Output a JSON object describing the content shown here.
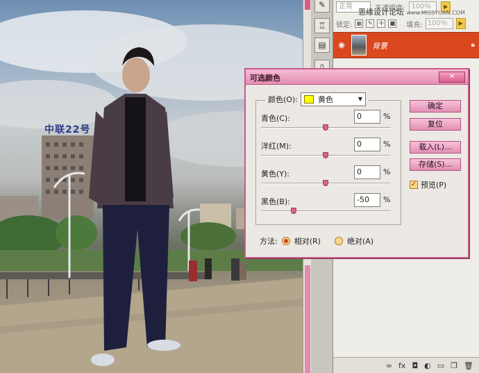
{
  "photo": {
    "building_sign": "中联22号"
  },
  "layers_panel": {
    "blend_mode": "正常",
    "opacity_label": "不透明度:",
    "opacity_value": "100%",
    "lock_label": "锁定:",
    "fill_label": "填充:",
    "fill_value": "100%",
    "watermark": "思缘设计论坛",
    "watermark_url": "www.MISSYUAN.COM",
    "layer_name": "背景"
  },
  "dialog": {
    "title": "可选颜色",
    "close_label": "✕",
    "colors_label": "颜色(O):",
    "colors_value": "黄色",
    "sliders": [
      {
        "label": "青色(C):",
        "value": "0",
        "unit": "%",
        "level": 0
      },
      {
        "label": "洋红(M):",
        "value": "0",
        "unit": "%",
        "level": 0
      },
      {
        "label": "黄色(Y):",
        "value": "0",
        "unit": "%",
        "level": 0
      },
      {
        "label": "黑色(B):",
        "value": "-50",
        "unit": "%",
        "level": -50
      }
    ],
    "method_label": "方法:",
    "method_relative": "相对(R)",
    "method_absolute": "绝对(A)",
    "method_selected": "relative",
    "buttons": {
      "ok": "确定",
      "reset": "复位",
      "load": "载入(L)...",
      "save": "存储(S)..."
    },
    "preview_label": "预览(P)",
    "preview_checked": true
  },
  "colors": {
    "accent": "#e290b4",
    "layer_selected": "#d9481f",
    "swatch_yellow": "#ffff00"
  }
}
